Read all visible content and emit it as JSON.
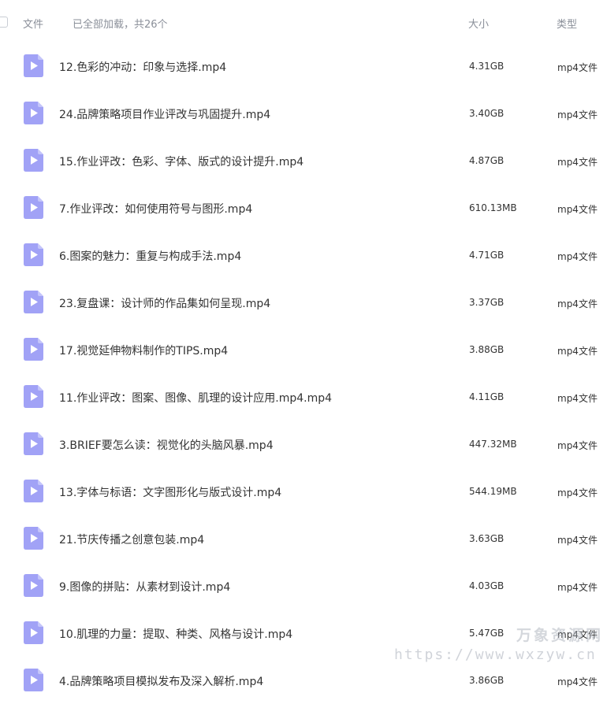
{
  "header": {
    "file_label": "文件",
    "status_text": "已全部加载，共26个",
    "size_label": "大小",
    "type_label": "类型"
  },
  "colors": {
    "icon_fill": "#a1a2f6",
    "icon_play": "#ffffff"
  },
  "files": [
    {
      "name": "12.色彩的冲动：印象与选择.mp4",
      "size": "4.31GB",
      "type": "mp4文件",
      "icon": "video-file-icon"
    },
    {
      "name": "24.品牌策略项目作业评改与巩固提升.mp4",
      "size": "3.40GB",
      "type": "mp4文件",
      "icon": "video-file-icon"
    },
    {
      "name": "15.作业评改：色彩、字体、版式的设计提升.mp4",
      "size": "4.87GB",
      "type": "mp4文件",
      "icon": "video-file-icon"
    },
    {
      "name": "7.作业评改：如何使用符号与图形.mp4",
      "size": "610.13MB",
      "type": "mp4文件",
      "icon": "video-file-icon"
    },
    {
      "name": "6.图案的魅力：重复与构成手法.mp4",
      "size": "4.71GB",
      "type": "mp4文件",
      "icon": "video-file-icon"
    },
    {
      "name": "23.复盘课：设计师的作品集如何呈现.mp4",
      "size": "3.37GB",
      "type": "mp4文件",
      "icon": "video-file-icon"
    },
    {
      "name": "17.视觉延伸物料制作的TIPS.mp4",
      "size": "3.88GB",
      "type": "mp4文件",
      "icon": "video-file-icon"
    },
    {
      "name": "11.作业评改：图案、图像、肌理的设计应用.mp4.mp4",
      "size": "4.11GB",
      "type": "mp4文件",
      "icon": "video-file-icon"
    },
    {
      "name": "3.BRIEF要怎么读：视觉化的头脑风暴.mp4",
      "size": "447.32MB",
      "type": "mp4文件",
      "icon": "video-file-icon"
    },
    {
      "name": "13.字体与标语：文字图形化与版式设计.mp4",
      "size": "544.19MB",
      "type": "mp4文件",
      "icon": "video-file-icon"
    },
    {
      "name": "21.节庆传播之创意包装.mp4",
      "size": "3.63GB",
      "type": "mp4文件",
      "icon": "video-file-icon"
    },
    {
      "name": "9.图像的拼贴：从素材到设计.mp4",
      "size": "4.03GB",
      "type": "mp4文件",
      "icon": "video-file-icon"
    },
    {
      "name": "10.肌理的力量：提取、种类、风格与设计.mp4",
      "size": "5.47GB",
      "type": "mp4文件",
      "icon": "video-file-icon"
    },
    {
      "name": "4.品牌策略项目模拟发布及深入解析.mp4",
      "size": "3.86GB",
      "type": "mp4文件",
      "icon": "video-file-icon"
    }
  ],
  "watermark": {
    "text": "万象资源网",
    "url": "https://www.wxzyw.cn"
  }
}
